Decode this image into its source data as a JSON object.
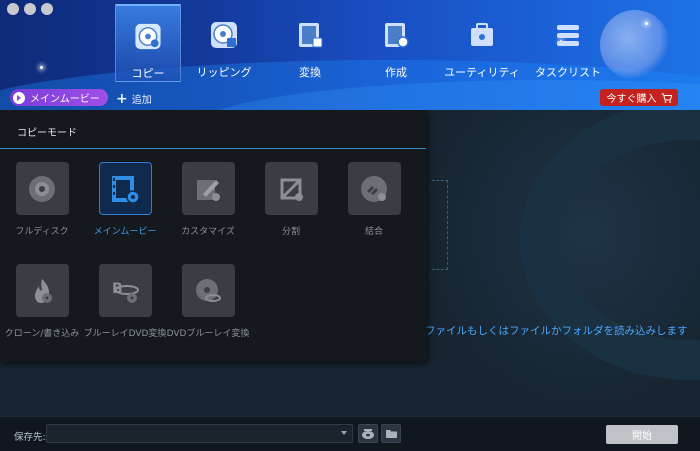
{
  "window": {
    "traffic_lights": [
      "close",
      "minimize",
      "maximize"
    ]
  },
  "nav": {
    "tabs": [
      {
        "label": "コピー",
        "icon": "disc-copy-icon",
        "active": true
      },
      {
        "label": "リッピング",
        "icon": "disc-rip-icon",
        "active": false
      },
      {
        "label": "変換",
        "icon": "film-convert-icon",
        "active": false
      },
      {
        "label": "作成",
        "icon": "film-create-icon",
        "active": false
      },
      {
        "label": "ユーティリティ",
        "icon": "toolbox-icon",
        "active": false
      },
      {
        "label": "タスクリスト",
        "icon": "task-list-icon",
        "active": false
      }
    ]
  },
  "toolbar": {
    "main_movie_label": "メインムービー",
    "add_label": "追加",
    "buy_label": "今すぐ購入"
  },
  "copy_panel": {
    "title": "コピーモード",
    "modes": [
      {
        "label": "フルディスク",
        "icon": "full-disc-icon",
        "active": false
      },
      {
        "label": "メインムービー",
        "icon": "main-movie-icon",
        "active": true
      },
      {
        "label": "カスタマイズ",
        "icon": "customize-icon",
        "active": false
      },
      {
        "label": "分割",
        "icon": "split-icon",
        "active": false
      },
      {
        "label": "結合",
        "icon": "merge-icon",
        "active": false
      },
      {
        "label": "クローン/書き込み",
        "icon": "clone-burn-icon",
        "active": false
      },
      {
        "label": "ブルーレイDVD変換",
        "icon": "bluray-to-dvd-icon",
        "active": false
      },
      {
        "label": "DVDブルーレイ変換",
        "icon": "dvd-to-bluray-icon",
        "active": false
      }
    ]
  },
  "main": {
    "hint_text": "ファイルもしくはファイルかフォルダを読み込みします"
  },
  "bottom": {
    "save_label": "保存先:",
    "save_value": "",
    "start_label": "開始"
  },
  "colors": {
    "accent": "#2f8fe8",
    "buy": "#c4221f",
    "active_tab_border": "#6fb2ff",
    "pill": "#8f45e0"
  }
}
